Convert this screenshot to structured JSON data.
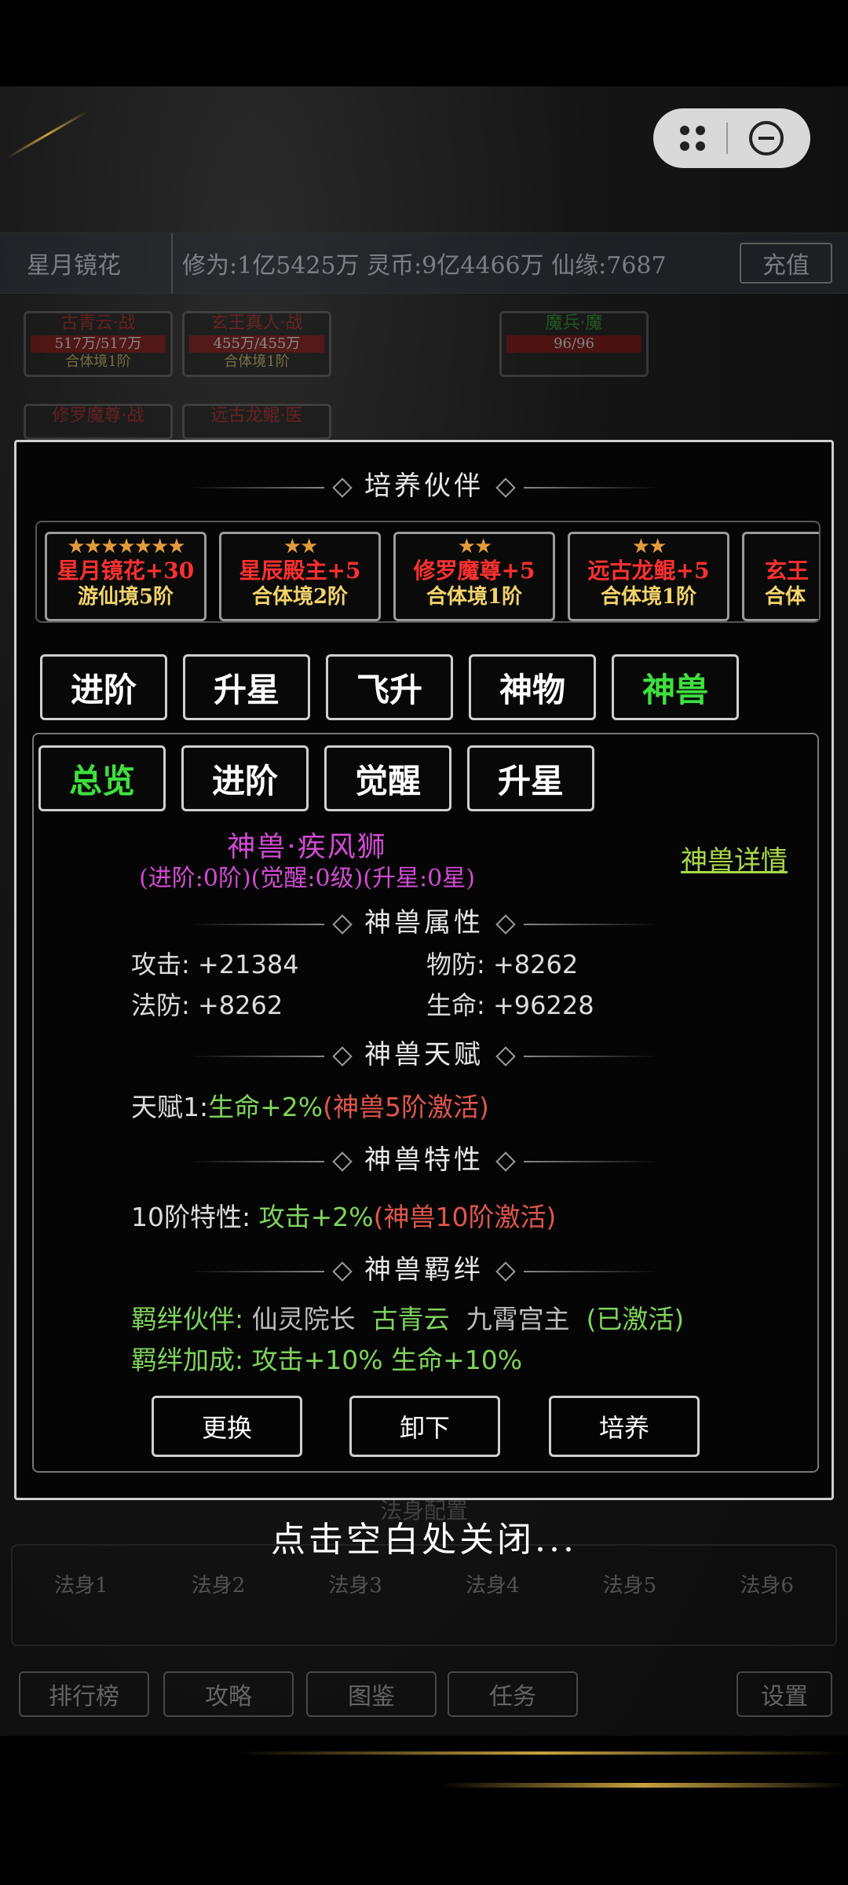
{
  "header": {
    "player_name": "星月镜花",
    "stats": "修为:1亿5425万  灵币:9亿4466万  仙缘:7687",
    "recharge": "充值"
  },
  "team_slots": [
    {
      "name": "古青云·战",
      "hp": "517万/517万",
      "level": "合体境1阶"
    },
    {
      "name": "玄王真人·战",
      "hp": "455万/455万",
      "level": "合体境1阶"
    },
    {
      "name": "魔兵·魔",
      "hp": "96/96",
      "level": ""
    },
    {
      "name": "修罗魔尊·战",
      "hp": "",
      "level": ""
    },
    {
      "name": "远古龙鲲·医",
      "hp": "",
      "level": ""
    }
  ],
  "modal": {
    "title": "培养伙伴",
    "partners": [
      {
        "stars": "★★★★★★★",
        "name": "星月镜花+30",
        "level": "游仙境5阶"
      },
      {
        "stars": "★★",
        "name": "星辰殿主+5",
        "level": "合体境2阶"
      },
      {
        "stars": "★★",
        "name": "修罗魔尊+5",
        "level": "合体境1阶"
      },
      {
        "stars": "★★",
        "name": "远古龙鲲+5",
        "level": "合体境1阶"
      },
      {
        "stars": "★",
        "name": "玄王",
        "level": "合体"
      }
    ],
    "main_tabs": [
      "进阶",
      "升星",
      "飞升",
      "神物",
      "神兽"
    ],
    "sub_tabs": [
      "总览",
      "进阶",
      "觉醒",
      "升星"
    ],
    "beast": {
      "name": "神兽·疾风狮",
      "levels": "(进阶:0阶)(觉醒:0级)(升星:0星)",
      "detail_link": "神兽详情"
    },
    "sections": {
      "attributes": "神兽属性",
      "talent": "神兽天赋",
      "trait": "神兽特性",
      "bond": "神兽羁绊"
    },
    "attributes": {
      "attack": "攻击: +21384",
      "phys_def": "物防: +8262",
      "magic_def": "法防: +8262",
      "hp": "生命: +96228"
    },
    "talent": {
      "label": "天赋1:",
      "effect": "生命+2%",
      "condition": "(神兽5阶激活)"
    },
    "trait": {
      "label": "10阶特性: ",
      "effect": "攻击+2%",
      "condition": "(神兽10阶激活)"
    },
    "bond": {
      "partner_label": "羁绊伙伴: ",
      "partner_1": "仙灵院长",
      "partner_2": "古青云",
      "partner_3": "九霄宫主",
      "status": "(已激活)",
      "bonus_label": "羁绊加成: ",
      "bonus": "攻击+10%  生命+10%"
    },
    "actions": [
      "更换",
      "卸下",
      "培养"
    ]
  },
  "close_hint": "点击空白处关闭...",
  "background_ui": {
    "fashen_title": "法身配置",
    "fashen_slots": [
      "法身1",
      "法身2",
      "法身3",
      "法身4",
      "法身5",
      "法身6"
    ],
    "bottom_menu": [
      "排行榜",
      "攻略",
      "图鉴",
      "任务",
      "设置"
    ]
  },
  "colors": {
    "active_tab": "#3ee03e",
    "partner_name": "#ff3030",
    "partner_level": "#f2d36a",
    "beast_name": "#d34bd3",
    "green_text": "#7ed35d",
    "red_text": "#e0564c",
    "detail_link": "#a8d848"
  }
}
